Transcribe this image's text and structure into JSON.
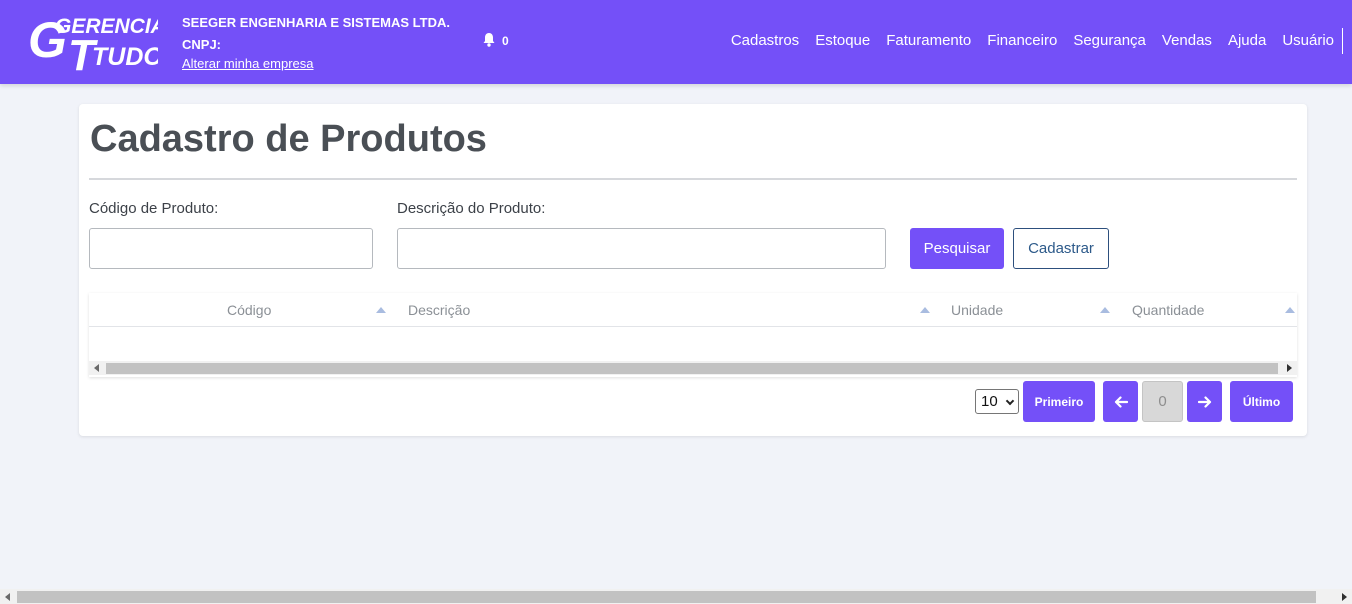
{
  "brand": {
    "line1": "GERENCIA",
    "line2": "TUDO",
    "big_g": "G",
    "big_t": "T",
    "color": "#7450f8"
  },
  "company": {
    "name": "SEEGER ENGENHARIA E SISTEMAS LTDA.",
    "cnpj_label": "CNPJ:",
    "change_link": "Alterar minha empresa"
  },
  "notifications": {
    "count": "0",
    "icon": "bell-icon"
  },
  "menu": [
    {
      "label": "Cadastros"
    },
    {
      "label": "Estoque"
    },
    {
      "label": "Faturamento"
    },
    {
      "label": "Financeiro"
    },
    {
      "label": "Segurança"
    },
    {
      "label": "Vendas"
    },
    {
      "label": "Ajuda"
    },
    {
      "label": "Usuário"
    }
  ],
  "page": {
    "title": "Cadastro de Produtos"
  },
  "form": {
    "code_label": "Código de Produto:",
    "code_value": "",
    "description_label": "Descrição do Produto:",
    "description_value": "",
    "search_button": "Pesquisar",
    "create_button": "Cadastrar"
  },
  "table": {
    "columns": [
      {
        "label": "Código"
      },
      {
        "label": "Descrição"
      },
      {
        "label": "Unidade"
      },
      {
        "label": "Quantidade"
      }
    ],
    "rows": []
  },
  "pagination": {
    "page_size": "10",
    "first": "Primeiro",
    "current": "0",
    "last": "Último",
    "prev_icon": "arrow-left-icon",
    "next_icon": "arrow-right-icon"
  }
}
